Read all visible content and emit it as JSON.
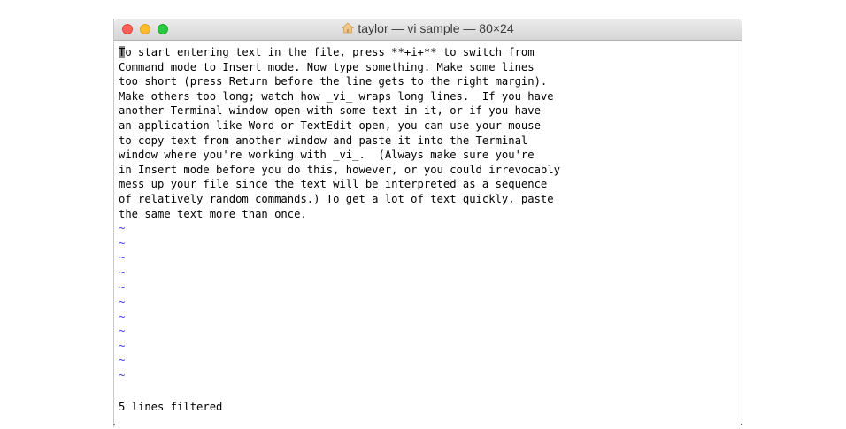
{
  "window": {
    "title": "taylor — vi sample — 80×24",
    "title_icon": "home-icon"
  },
  "editor": {
    "cursor_char": "T",
    "first_line_rest": "o start entering text in the file, press **+i+** to switch from",
    "lines": [
      "Command mode to Insert mode. Now type something. Make some lines",
      "too short (press Return before the line gets to the right margin).",
      "Make others too long; watch how _vi_ wraps long lines.  If you have",
      "another Terminal window open with some text in it, or if you have",
      "an application like Word or TextEdit open, you can use your mouse",
      "to copy text from another window and paste it into the Terminal",
      "window where you're working with _vi_.  (Always make sure you're",
      "in Insert mode before you do this, however, or you could irrevocably",
      "mess up your file since the text will be interpreted as a sequence",
      "of relatively random commands.) To get a lot of text quickly, paste",
      "the same text more than once."
    ],
    "empty_line_markers": [
      "~",
      "~",
      "~",
      "~",
      "~",
      "~",
      "~",
      "~",
      "~",
      "~",
      "~"
    ],
    "status_message": "5 lines filtered"
  },
  "colors": {
    "tilde": "#3b3bd6",
    "cursor": "#8a8a8a"
  }
}
